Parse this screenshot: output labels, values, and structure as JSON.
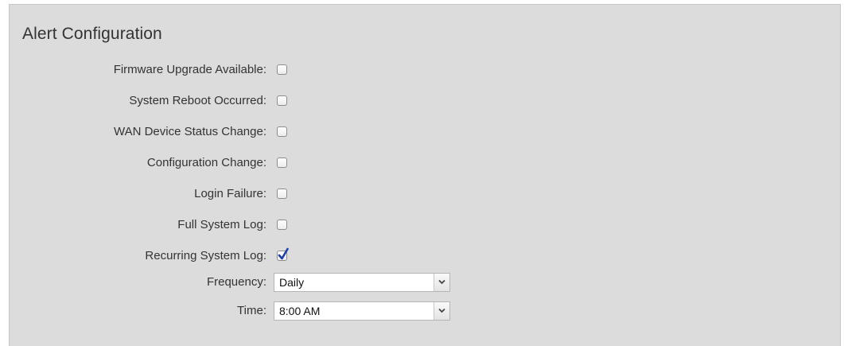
{
  "section": {
    "title": "Alert Configuration"
  },
  "alerts": [
    {
      "label": "Firmware Upgrade Available:",
      "checked": false
    },
    {
      "label": "System Reboot Occurred:",
      "checked": false
    },
    {
      "label": "WAN Device Status Change:",
      "checked": false
    },
    {
      "label": "Configuration Change:",
      "checked": false
    },
    {
      "label": "Login Failure:",
      "checked": false
    },
    {
      "label": "Full System Log:",
      "checked": false
    },
    {
      "label": "Recurring System Log:",
      "checked": true
    }
  ],
  "frequency": {
    "label": "Frequency:",
    "value": "Daily"
  },
  "time": {
    "label": "Time:",
    "value": "8:00 AM"
  },
  "colors": {
    "panel_background": "#dcdcdc",
    "check_color": "#1f3fa8"
  }
}
